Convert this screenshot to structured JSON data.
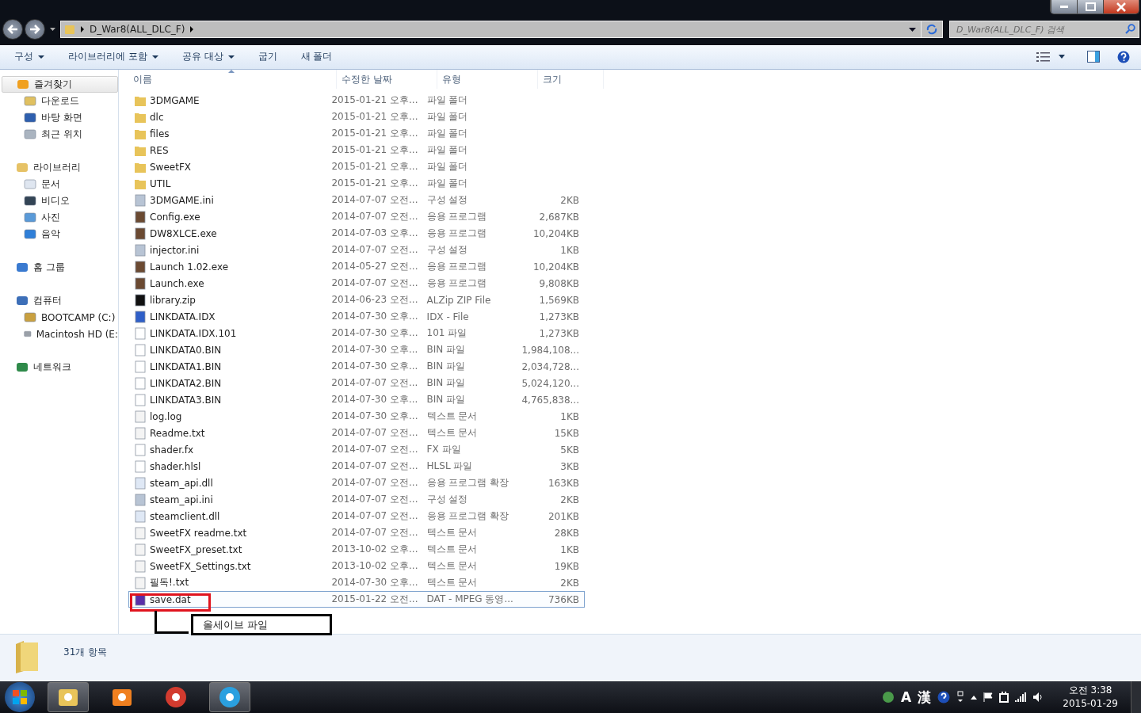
{
  "address": {
    "crumbs": [
      "D_War8(ALL_DLC_F)"
    ]
  },
  "search": {
    "placeholder": "D_War8(ALL_DLC_F) 검색"
  },
  "toolbar": [
    {
      "label": "구성",
      "has_menu": true
    },
    {
      "label": "라이브러리에 포함",
      "has_menu": true
    },
    {
      "label": "공유 대상",
      "has_menu": true
    },
    {
      "label": "굽기",
      "has_menu": false
    },
    {
      "label": "새 폴더",
      "has_menu": false
    }
  ],
  "sidebar": [
    {
      "label": "즐겨찾기",
      "selected": true,
      "children": [
        {
          "label": "다운로드"
        },
        {
          "label": "바탕 화면"
        },
        {
          "label": "최근 위치"
        }
      ]
    },
    {
      "label": "라이브러리",
      "selected": false,
      "children": [
        {
          "label": "문서"
        },
        {
          "label": "비디오"
        },
        {
          "label": "사진"
        },
        {
          "label": "음악"
        }
      ]
    },
    {
      "label": "홈 그룹",
      "selected": false
    },
    {
      "label": "컴퓨터",
      "selected": false,
      "children": [
        {
          "label": "BOOTCAMP (C:)"
        },
        {
          "label": "Macintosh HD (E:"
        }
      ]
    },
    {
      "label": "네트워크",
      "selected": false
    }
  ],
  "table": {
    "columns": [
      {
        "label": "이름",
        "sorted": true
      },
      {
        "label": "수정한 날짜",
        "sorted": false
      },
      {
        "label": "유형",
        "sorted": false
      },
      {
        "label": "크기",
        "sorted": false
      }
    ],
    "rows": [
      {
        "name": "3DMGAME",
        "date": "2015-01-21 오후...",
        "type": "파일 폴더",
        "size": "",
        "kind": "folder",
        "selected": false
      },
      {
        "name": "dlc",
        "date": "2015-01-21 오후...",
        "type": "파일 폴더",
        "size": "",
        "kind": "folder",
        "selected": false
      },
      {
        "name": "files",
        "date": "2015-01-21 오후...",
        "type": "파일 폴더",
        "size": "",
        "kind": "folder",
        "selected": false
      },
      {
        "name": "RES",
        "date": "2015-01-21 오후...",
        "type": "파일 폴더",
        "size": "",
        "kind": "folder",
        "selected": false
      },
      {
        "name": "SweetFX",
        "date": "2015-01-21 오후...",
        "type": "파일 폴더",
        "size": "",
        "kind": "folder",
        "selected": false
      },
      {
        "name": "UTIL",
        "date": "2015-01-21 오후...",
        "type": "파일 폴더",
        "size": "",
        "kind": "folder",
        "selected": false
      },
      {
        "name": "3DMGAME.ini",
        "date": "2014-07-07 오전...",
        "type": "구성 설정",
        "size": "2KB",
        "kind": "ini",
        "selected": false
      },
      {
        "name": "Config.exe",
        "date": "2014-07-07 오전...",
        "type": "응용 프로그램",
        "size": "2,687KB",
        "kind": "exe",
        "selected": false
      },
      {
        "name": "DW8XLCE.exe",
        "date": "2014-07-03 오후...",
        "type": "응용 프로그램",
        "size": "10,204KB",
        "kind": "exe",
        "selected": false
      },
      {
        "name": "injector.ini",
        "date": "2014-07-07 오전...",
        "type": "구성 설정",
        "size": "1KB",
        "kind": "ini",
        "selected": false
      },
      {
        "name": "Launch 1.02.exe",
        "date": "2014-05-27 오전...",
        "type": "응용 프로그램",
        "size": "10,204KB",
        "kind": "exe",
        "selected": false
      },
      {
        "name": "Launch.exe",
        "date": "2014-07-07 오전...",
        "type": "응용 프로그램",
        "size": "9,808KB",
        "kind": "exe",
        "selected": false
      },
      {
        "name": "library.zip",
        "date": "2014-06-23 오전...",
        "type": "ALZip ZIP File",
        "size": "1,569KB",
        "kind": "zip",
        "selected": false
      },
      {
        "name": "LINKDATA.IDX",
        "date": "2014-07-30 오후...",
        "type": "IDX - File",
        "size": "1,273KB",
        "kind": "idx",
        "selected": false
      },
      {
        "name": "LINKDATA.IDX.101",
        "date": "2014-07-30 오후...",
        "type": "101 파일",
        "size": "1,273KB",
        "kind": "file",
        "selected": false
      },
      {
        "name": "LINKDATA0.BIN",
        "date": "2014-07-30 오후...",
        "type": "BIN 파일",
        "size": "1,984,108...",
        "kind": "file",
        "selected": false
      },
      {
        "name": "LINKDATA1.BIN",
        "date": "2014-07-30 오후...",
        "type": "BIN 파일",
        "size": "2,034,728...",
        "kind": "file",
        "selected": false
      },
      {
        "name": "LINKDATA2.BIN",
        "date": "2014-07-07 오전...",
        "type": "BIN 파일",
        "size": "5,024,120...",
        "kind": "file",
        "selected": false
      },
      {
        "name": "LINKDATA3.BIN",
        "date": "2014-07-30 오후...",
        "type": "BIN 파일",
        "size": "4,765,838...",
        "kind": "file",
        "selected": false
      },
      {
        "name": "log.log",
        "date": "2014-07-30 오후...",
        "type": "텍스트 문서",
        "size": "1KB",
        "kind": "txt",
        "selected": false
      },
      {
        "name": "Readme.txt",
        "date": "2014-07-07 오전...",
        "type": "텍스트 문서",
        "size": "15KB",
        "kind": "txt",
        "selected": false
      },
      {
        "name": "shader.fx",
        "date": "2014-07-07 오전...",
        "type": "FX 파일",
        "size": "5KB",
        "kind": "file",
        "selected": false
      },
      {
        "name": "shader.hlsl",
        "date": "2014-07-07 오전...",
        "type": "HLSL 파일",
        "size": "3KB",
        "kind": "file",
        "selected": false
      },
      {
        "name": "steam_api.dll",
        "date": "2014-07-07 오전...",
        "type": "응용 프로그램 확장",
        "size": "163KB",
        "kind": "dll",
        "selected": false
      },
      {
        "name": "steam_api.ini",
        "date": "2014-07-07 오전...",
        "type": "구성 설정",
        "size": "2KB",
        "kind": "ini",
        "selected": false
      },
      {
        "name": "steamclient.dll",
        "date": "2014-07-07 오전...",
        "type": "응용 프로그램 확장",
        "size": "201KB",
        "kind": "dll",
        "selected": false
      },
      {
        "name": "SweetFX readme.txt",
        "date": "2014-07-07 오전...",
        "type": "텍스트 문서",
        "size": "28KB",
        "kind": "txt",
        "selected": false
      },
      {
        "name": "SweetFX_preset.txt",
        "date": "2013-10-02 오후...",
        "type": "텍스트 문서",
        "size": "1KB",
        "kind": "txt",
        "selected": false
      },
      {
        "name": "SweetFX_Settings.txt",
        "date": "2013-10-02 오후...",
        "type": "텍스트 문서",
        "size": "19KB",
        "kind": "txt",
        "selected": false
      },
      {
        "name": "필독!.txt",
        "date": "2014-07-30 오후...",
        "type": "텍스트 문서",
        "size": "2KB",
        "kind": "txt",
        "selected": false
      },
      {
        "name": "save.dat",
        "date": "2015-01-22 오전...",
        "type": "DAT - MPEG 동영...",
        "size": "736KB",
        "kind": "dat",
        "selected": true
      }
    ]
  },
  "annotation": {
    "label": "올세이브 파일"
  },
  "status_bar": {
    "count": "31개 항목"
  },
  "taskbar": {
    "apps": [
      {
        "kind": "explorer",
        "active": true
      },
      {
        "kind": "media",
        "active": false
      },
      {
        "kind": "chrome",
        "active": false
      },
      {
        "kind": "ie",
        "active": true
      }
    ],
    "ime": [
      "A",
      "漢"
    ],
    "time": "오전 3:38",
    "date": "2015-01-29"
  }
}
